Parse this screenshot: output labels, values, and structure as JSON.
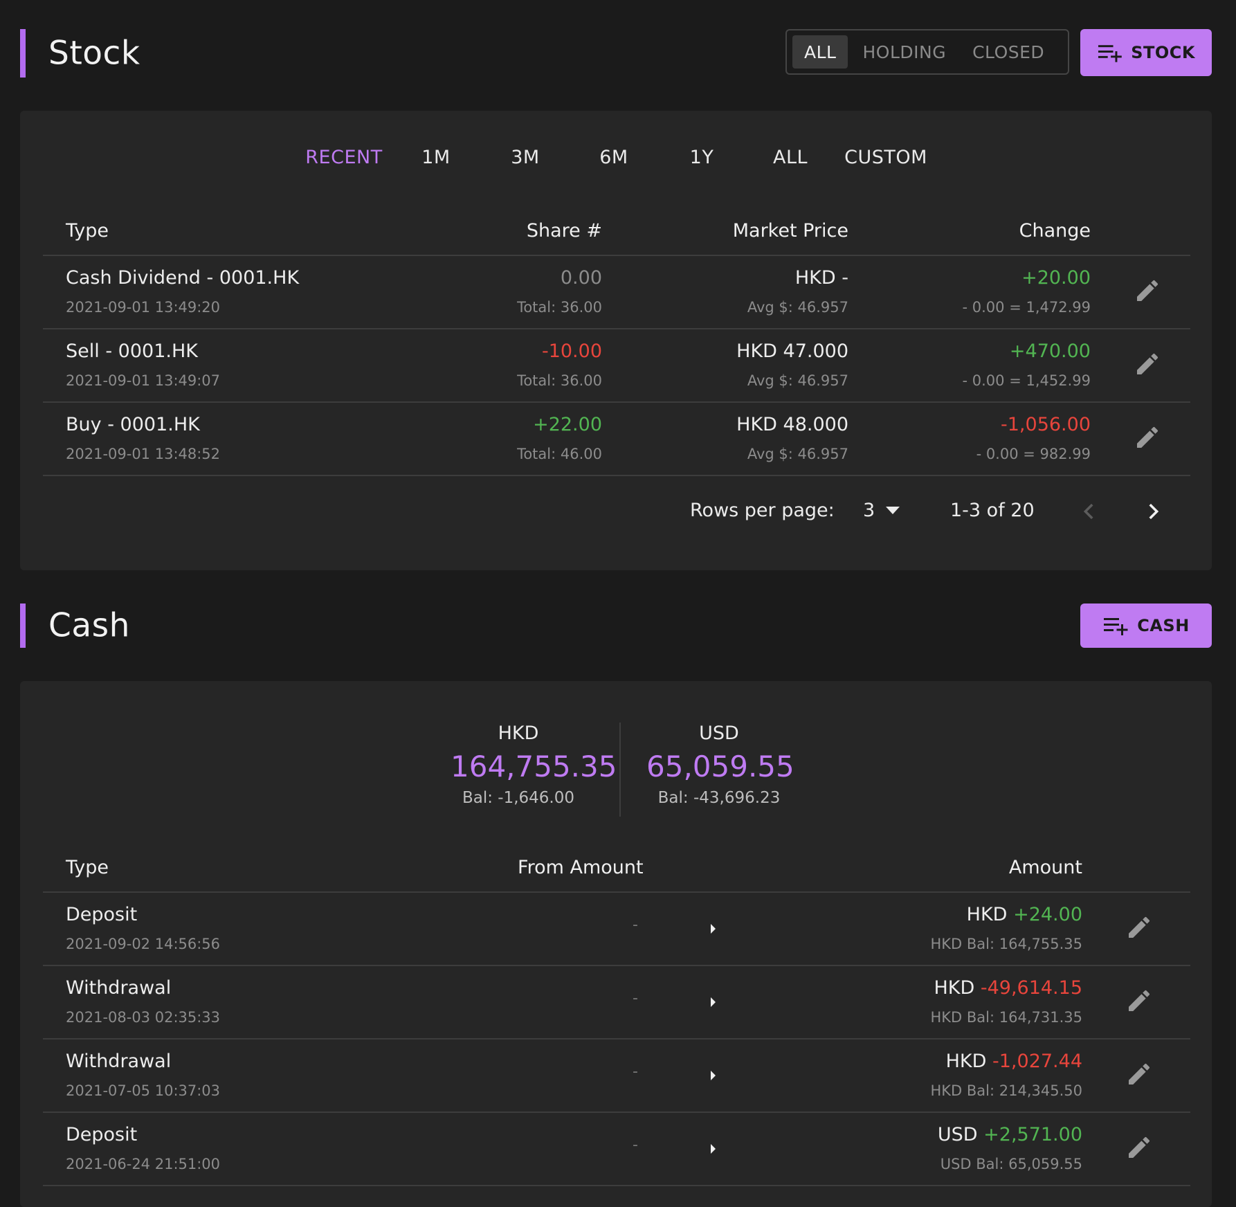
{
  "colors": {
    "accent": "#bf7bf2",
    "positive": "#52b552",
    "negative": "#e8453c",
    "background": "#1b1b1b",
    "card": "#262626"
  },
  "stock": {
    "title": "Stock",
    "filters": [
      "ALL",
      "HOLDING",
      "CLOSED"
    ],
    "active_filter": "ALL",
    "add_label": "STOCK",
    "add_icon": "playlist-add-icon",
    "ranges": [
      "RECENT",
      "1M",
      "3M",
      "6M",
      "1Y",
      "ALL",
      "CUSTOM"
    ],
    "active_range": "RECENT",
    "columns": {
      "type": "Type",
      "shares": "Share #",
      "price": "Market Price",
      "change": "Change"
    },
    "rows": [
      {
        "type": "Cash Dividend - 0001.HK",
        "date": "2021-09-01 13:49:20",
        "shares": "0.00",
        "shares_tone": "muted",
        "total": "Total: 36.00",
        "price": "HKD -",
        "avg": "Avg $: 46.957",
        "change": "+20.00",
        "change_tone": "pos",
        "change_sub": "- 0.00 = 1,472.99"
      },
      {
        "type": "Sell - 0001.HK",
        "date": "2021-09-01 13:49:07",
        "shares": "-10.00",
        "shares_tone": "neg",
        "total": "Total: 36.00",
        "price": "HKD 47.000",
        "avg": "Avg $: 46.957",
        "change": "+470.00",
        "change_tone": "pos",
        "change_sub": "- 0.00 = 1,452.99"
      },
      {
        "type": "Buy - 0001.HK",
        "date": "2021-09-01 13:48:52",
        "shares": "+22.00",
        "shares_tone": "pos",
        "total": "Total: 46.00",
        "price": "HKD 48.000",
        "avg": "Avg $: 46.957",
        "change": "-1,056.00",
        "change_tone": "neg",
        "change_sub": "- 0.00 = 982.99"
      }
    ],
    "pagination": {
      "rows_label": "Rows per page:",
      "rows_value": "3",
      "range_text": "1-3 of 20"
    }
  },
  "cash": {
    "title": "Cash",
    "add_label": "CASH",
    "add_icon": "playlist-add-icon",
    "balances": [
      {
        "currency": "HKD",
        "amount": "164,755.35",
        "bal": "Bal: -1,646.00"
      },
      {
        "currency": "USD",
        "amount": "65,059.55",
        "bal": "Bal: -43,696.23"
      }
    ],
    "columns": {
      "type": "Type",
      "from": "From Amount",
      "amount": "Amount"
    },
    "rows": [
      {
        "type": "Deposit",
        "date": "2021-09-02 14:56:56",
        "from": "-",
        "currency": "HKD",
        "amount": "+24.00",
        "amount_tone": "pos",
        "bal": "HKD Bal: 164,755.35"
      },
      {
        "type": "Withdrawal",
        "date": "2021-08-03 02:35:33",
        "from": "-",
        "currency": "HKD",
        "amount": "-49,614.15",
        "amount_tone": "neg",
        "bal": "HKD Bal: 164,731.35"
      },
      {
        "type": "Withdrawal",
        "date": "2021-07-05 10:37:03",
        "from": "-",
        "currency": "HKD",
        "amount": "-1,027.44",
        "amount_tone": "neg",
        "bal": "HKD Bal: 214,345.50"
      },
      {
        "type": "Deposit",
        "date": "2021-06-24 21:51:00",
        "from": "-",
        "currency": "USD",
        "amount": "+2,571.00",
        "amount_tone": "pos",
        "bal": "USD Bal: 65,059.55"
      }
    ]
  }
}
